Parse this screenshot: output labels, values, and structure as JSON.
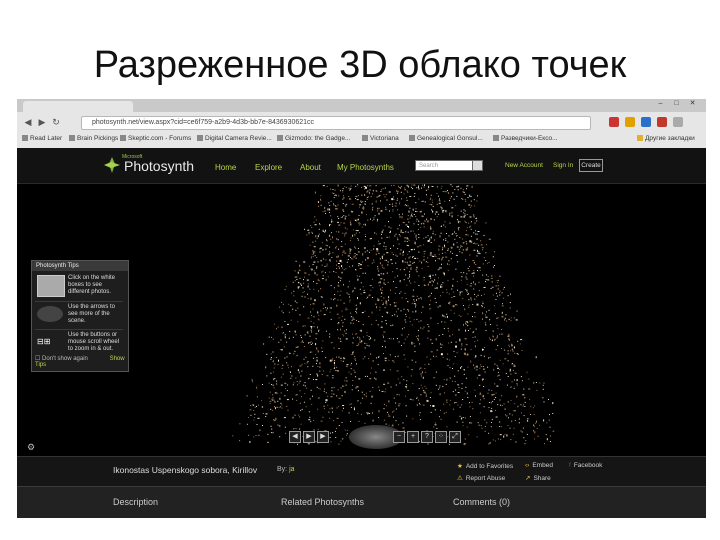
{
  "slide": {
    "title": "Разреженное 3D облако точек"
  },
  "browser": {
    "url": "photosynth.net/view.aspx?cid=ce6f759-a2b9-4d3b-bb7e-8436930621cc",
    "bookmarks": [
      "Read Later",
      "Brain Pickings",
      "Skeptic.com - Forums",
      "Digital Camera Revie...",
      "Gizmodo: the Gadge...",
      "Victoriana",
      "Genealogical Gonsul...",
      "Разведчики-Ексо...",
      "Другие закладки"
    ]
  },
  "site": {
    "logo_small": "Microsoft",
    "logo": "Photosynth",
    "nav": [
      "Home",
      "Explore",
      "About",
      "My Photosynths"
    ],
    "search_placeholder": "Search",
    "new_account": "New Account",
    "sign_in": "Sign In",
    "create": "Create"
  },
  "help": {
    "title": "Photosynth Tips",
    "tip1": "Click on the white boxes to see different photos.",
    "tip2": "Use the arrows to see more of the scene.",
    "tip3": "Use the buttons or mouse scroll wheel to zoom in & out.",
    "dont_show": "Don't show again",
    "show_tips": "Show Tips"
  },
  "info": {
    "title": "Ikonostas Uspenskogo sobora, Kirillov",
    "by_label": "By:",
    "author": "ja",
    "add_favorites": "Add to Favorites",
    "report_abuse": "Report Abuse",
    "embed": "Embed",
    "share": "Share",
    "facebook": "Facebook"
  },
  "tabs": {
    "description": "Description",
    "related": "Related Photosynths",
    "comments": "Comments",
    "comments_count": "(0)"
  }
}
